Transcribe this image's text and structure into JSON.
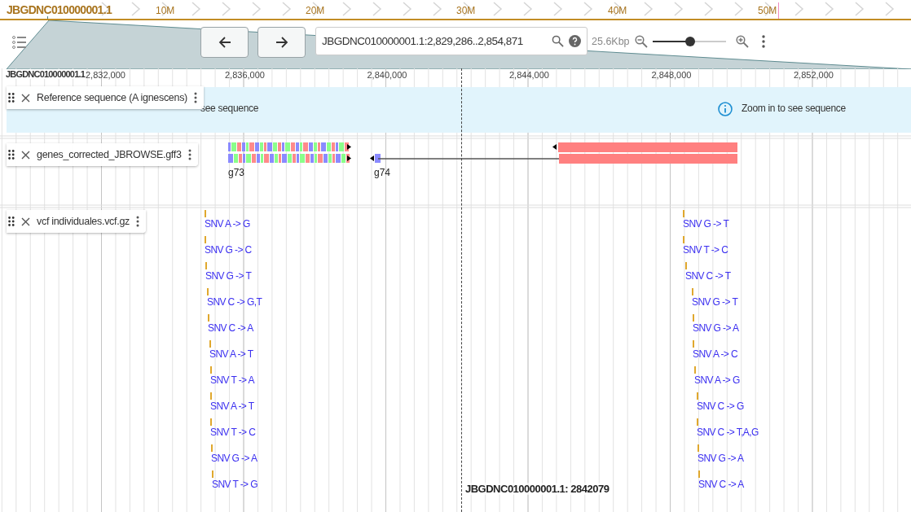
{
  "overview": {
    "refname": "JBGDNC010000001.1",
    "ticks": [
      "10M",
      "20M",
      "30M",
      "40M",
      "50M"
    ]
  },
  "toolbar": {
    "location": "JBGDNC010000001.1:2,829,286..2,854,871",
    "bp_per_view": "25.6Kbp",
    "zoom": {
      "level": 0.52
    }
  },
  "ruler": {
    "refname": "JBGDNC010000001.1",
    "ticks": [
      "2,832,000",
      "2,836,000",
      "2,840,000",
      "2,844,000",
      "2,848,000",
      "2,852,000"
    ]
  },
  "tracks": [
    {
      "kind": "sequence",
      "name": "Reference sequence (A ignescens)",
      "messages": [
        {
          "text": "see sequence",
          "icon": false
        },
        {
          "text": "Zoom in to see sequence",
          "icon": true
        }
      ]
    },
    {
      "kind": "features",
      "name": "genes_corrected_JBROWSE.gff3",
      "labels": [
        "g73",
        "g74"
      ]
    },
    {
      "kind": "variants",
      "name": "vcf individuales.vcf.gz",
      "columns": [
        [
          "SNV A -> G",
          "SNV G -> C",
          "SNV G -> T",
          "SNV C -> G,T",
          "SNV C -> A",
          "SNV A -> T",
          "SNV T -> A",
          "SNV A -> T",
          "SNV T -> C",
          "SNV G -> A",
          "SNV T -> G"
        ],
        [
          "SNV G -> T",
          "SNV T -> C",
          "SNV C -> T",
          "SNV G -> T",
          "SNV G -> A",
          "SNV A -> C",
          "SNV A -> G",
          "SNV C -> G",
          "SNV C -> T,A,G",
          "SNV G -> A",
          "SNV C -> A"
        ]
      ]
    }
  ],
  "center_marker": {
    "label": "JBGDNC010000001.1: 2842079"
  }
}
